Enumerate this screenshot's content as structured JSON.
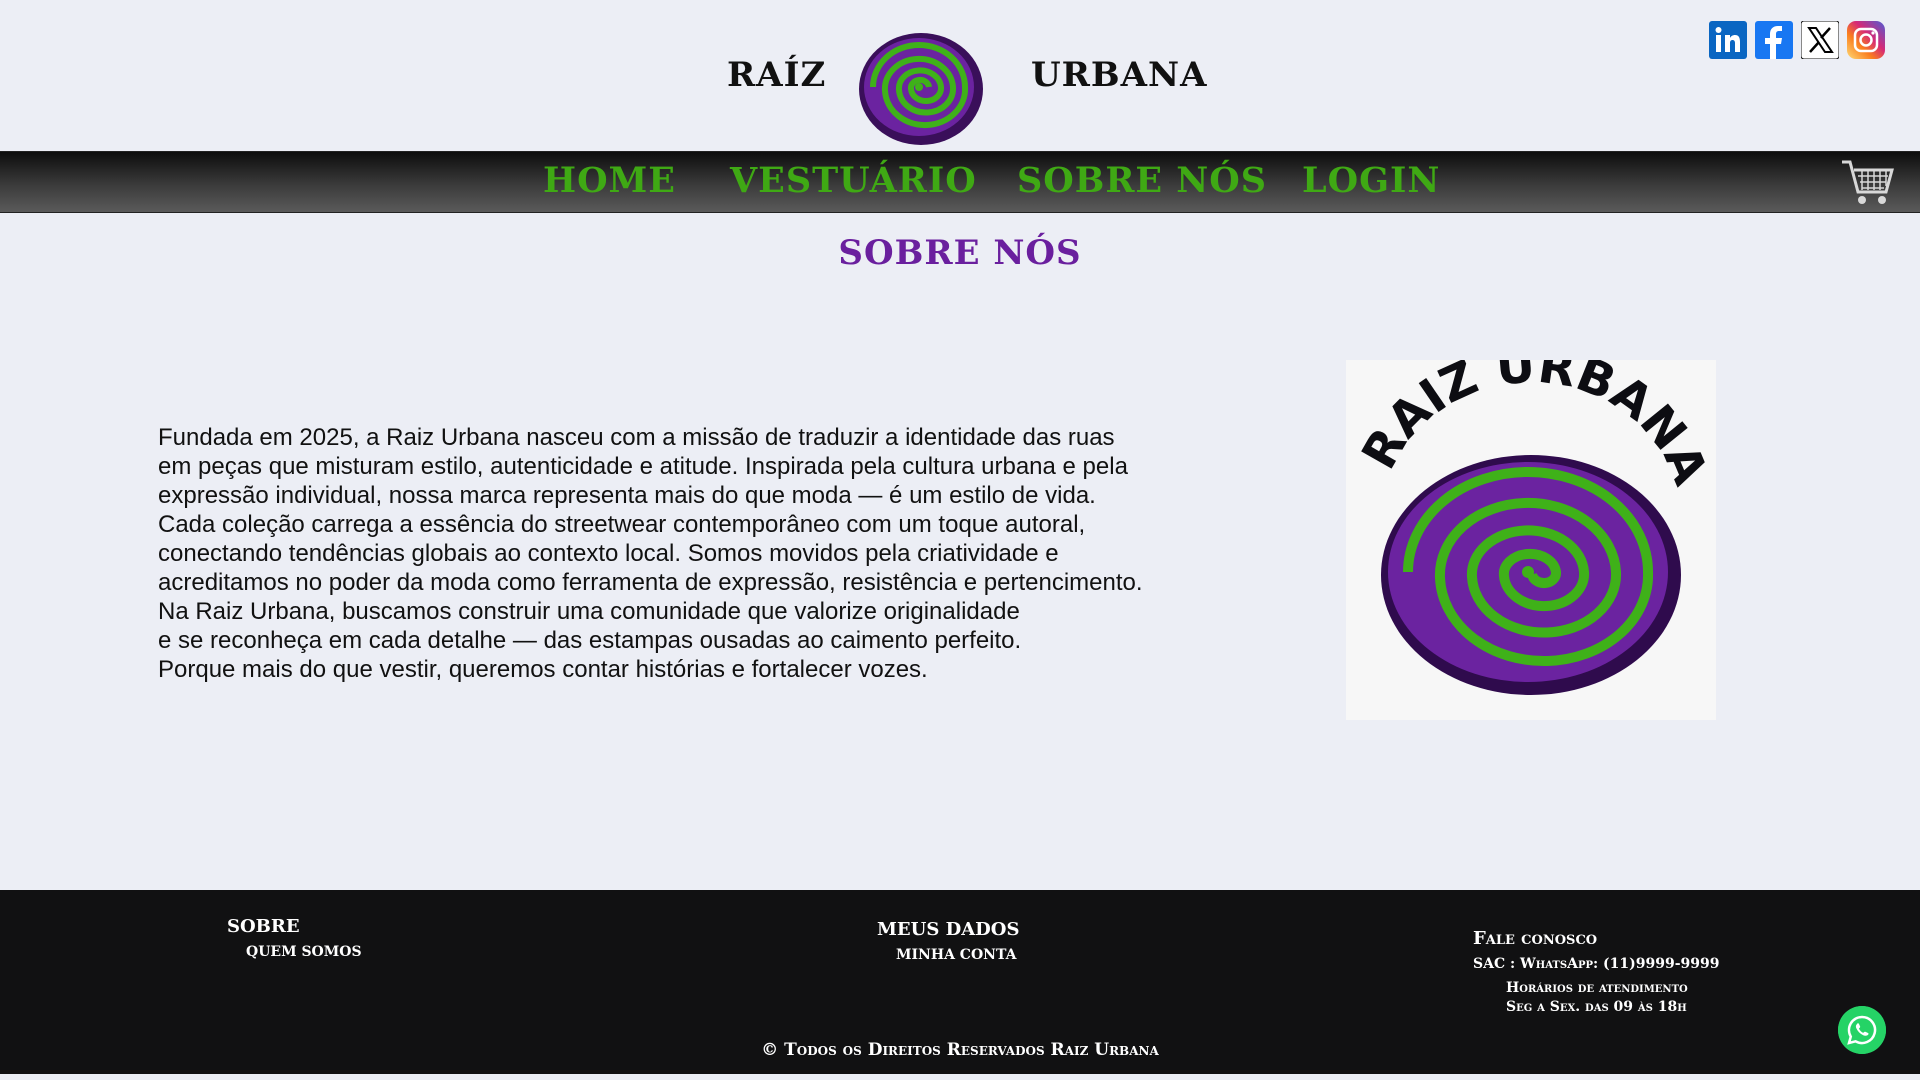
{
  "header": {
    "brand_left": "RAÍZ",
    "brand_right": "URBANA",
    "logo_icon": "swirl-logo-icon",
    "socials": [
      {
        "name": "LinkedIn",
        "icon": "linkedin-icon",
        "color": "#0a66c2"
      },
      {
        "name": "Facebook",
        "icon": "facebook-icon",
        "color": "#1877f2"
      },
      {
        "name": "X",
        "icon": "x-icon",
        "color": "#000000"
      },
      {
        "name": "Instagram",
        "icon": "instagram-icon",
        "color": "#d6249f"
      }
    ]
  },
  "nav": {
    "items": [
      "HOME",
      "VESTUÁRIO",
      "SOBRE NÓS",
      "LOGIN"
    ],
    "cart_icon": "shopping-cart-icon",
    "color": "#3fa914"
  },
  "main": {
    "title": "SOBRE NÓS",
    "title_color": "#6a1f9e",
    "paragraph_lines": [
      "Fundada em 2025, a Raiz Urbana nasceu com a missão de traduzir a identidade das ruas",
      "em peças que misturam estilo, autenticidade e atitude. Inspirada pela cultura urbana e pela",
      "expressão individual, nossa marca representa mais do que moda — é um estilo de vida.",
      "Cada coleção carrega a essência do streetwear contemporâneo com um toque autoral,",
      "conectando tendências globais ao contexto local. Somos movidos pela criatividade e",
      "acreditamos no poder da moda como ferramenta de expressão, resistência e pertencimento.",
      "Na Raiz Urbana, buscamos construir uma comunidade que valorize originalidade",
      "e se reconheça em cada detalhe — das estampas ousadas ao caimento perfeito.",
      "Porque mais do que vestir, queremos contar histórias e fortalecer vozes."
    ],
    "image_text": "RAIZ URBANA"
  },
  "footer": {
    "sobre": {
      "heading": "SOBRE",
      "link": "QUEM SOMOS"
    },
    "meus_dados": {
      "heading": "MEUS DADOS",
      "link": "MINHA CONTA"
    },
    "fale": {
      "heading": "Fale conosco",
      "sac": "SAC : WhatsApp: (11)9999-9999",
      "horarios": "Horários de atendimento",
      "dias": "Seg a Sex. das 09 às 18h"
    },
    "copyright": "© Todos os Direitos Reservados Raiz Urbana",
    "whatsapp_icon": "whatsapp-icon"
  }
}
